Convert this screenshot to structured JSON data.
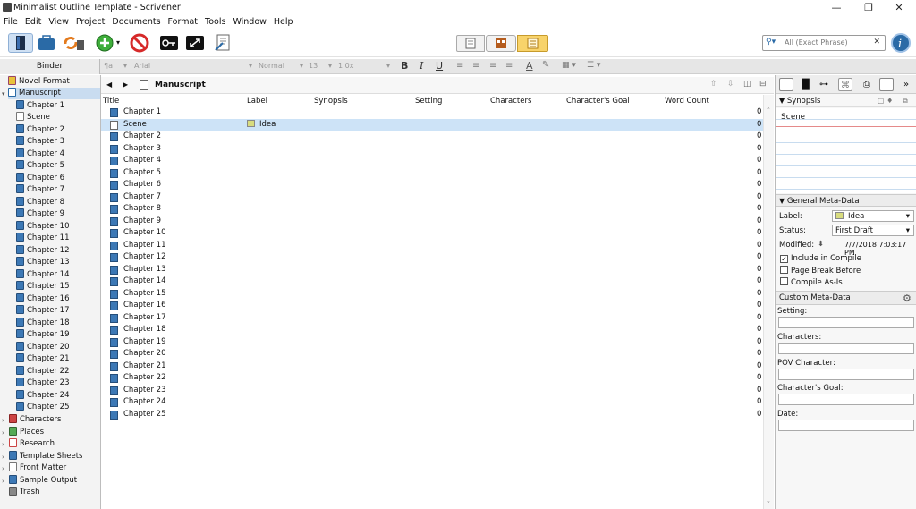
{
  "window": {
    "title": "Minimalist Outline Template - Scrivener",
    "min": "—",
    "max": "❐",
    "close": "✕"
  },
  "menu": [
    "File",
    "Edit",
    "View",
    "Project",
    "Documents",
    "Format",
    "Tools",
    "Window",
    "Help"
  ],
  "search": {
    "placeholder": "All (Exact Phrase)"
  },
  "format_bar": {
    "style": "¶a",
    "font": "Arial",
    "weight": "Normal",
    "size": "13",
    "spacing": "1.0x"
  },
  "binder": {
    "header": "Binder",
    "items": [
      {
        "label": "Novel Format"
      },
      {
        "label": "Manuscript"
      },
      {
        "label": "Chapter 1"
      },
      {
        "label": "Scene"
      },
      {
        "label": "Chapter 2"
      },
      {
        "label": "Chapter 3"
      },
      {
        "label": "Chapter 4"
      },
      {
        "label": "Chapter 5"
      },
      {
        "label": "Chapter 6"
      },
      {
        "label": "Chapter 7"
      },
      {
        "label": "Chapter 8"
      },
      {
        "label": "Chapter 9"
      },
      {
        "label": "Chapter 10"
      },
      {
        "label": "Chapter 11"
      },
      {
        "label": "Chapter 12"
      },
      {
        "label": "Chapter 13"
      },
      {
        "label": "Chapter 14"
      },
      {
        "label": "Chapter 15"
      },
      {
        "label": "Chapter 16"
      },
      {
        "label": "Chapter 17"
      },
      {
        "label": "Chapter 18"
      },
      {
        "label": "Chapter 19"
      },
      {
        "label": "Chapter 20"
      },
      {
        "label": "Chapter 21"
      },
      {
        "label": "Chapter 22"
      },
      {
        "label": "Chapter 23"
      },
      {
        "label": "Chapter 24"
      },
      {
        "label": "Chapter 25"
      },
      {
        "label": "Characters"
      },
      {
        "label": "Places"
      },
      {
        "label": "Research"
      },
      {
        "label": "Template Sheets"
      },
      {
        "label": "Front Matter"
      },
      {
        "label": "Sample Output"
      },
      {
        "label": "Trash"
      }
    ]
  },
  "outliner": {
    "title": "Manuscript",
    "columns": [
      "Title",
      "Label",
      "Synopsis",
      "Setting",
      "Characters",
      "Character's Goal",
      "Word Count"
    ],
    "rows": [
      {
        "title": "Chapter 1",
        "label": "",
        "wc": "0"
      },
      {
        "title": "Scene",
        "label": "Idea",
        "wc": "0"
      },
      {
        "title": "Chapter 2",
        "label": "",
        "wc": "0"
      },
      {
        "title": "Chapter 3",
        "label": "",
        "wc": "0"
      },
      {
        "title": "Chapter 4",
        "label": "",
        "wc": "0"
      },
      {
        "title": "Chapter 5",
        "label": "",
        "wc": "0"
      },
      {
        "title": "Chapter 6",
        "label": "",
        "wc": "0"
      },
      {
        "title": "Chapter 7",
        "label": "",
        "wc": "0"
      },
      {
        "title": "Chapter 8",
        "label": "",
        "wc": "0"
      },
      {
        "title": "Chapter 9",
        "label": "",
        "wc": "0"
      },
      {
        "title": "Chapter 10",
        "label": "",
        "wc": "0"
      },
      {
        "title": "Chapter 11",
        "label": "",
        "wc": "0"
      },
      {
        "title": "Chapter 12",
        "label": "",
        "wc": "0"
      },
      {
        "title": "Chapter 13",
        "label": "",
        "wc": "0"
      },
      {
        "title": "Chapter 14",
        "label": "",
        "wc": "0"
      },
      {
        "title": "Chapter 15",
        "label": "",
        "wc": "0"
      },
      {
        "title": "Chapter 16",
        "label": "",
        "wc": "0"
      },
      {
        "title": "Chapter 17",
        "label": "",
        "wc": "0"
      },
      {
        "title": "Chapter 18",
        "label": "",
        "wc": "0"
      },
      {
        "title": "Chapter 19",
        "label": "",
        "wc": "0"
      },
      {
        "title": "Chapter 20",
        "label": "",
        "wc": "0"
      },
      {
        "title": "Chapter 21",
        "label": "",
        "wc": "0"
      },
      {
        "title": "Chapter 22",
        "label": "",
        "wc": "0"
      },
      {
        "title": "Chapter 23",
        "label": "",
        "wc": "0"
      },
      {
        "title": "Chapter 24",
        "label": "",
        "wc": "0"
      },
      {
        "title": "Chapter 25",
        "label": "",
        "wc": "0"
      }
    ]
  },
  "inspector": {
    "synopsis_header": "Synopsis",
    "synopsis_text": "Scene",
    "general_header": "General Meta-Data",
    "label_caption": "Label:",
    "label_value": "Idea",
    "status_caption": "Status:",
    "status_value": "First Draft",
    "modified_caption": "Modified:",
    "modified_value": "7/7/2018 7:03:17 PM",
    "include_in_compile": "Include in Compile",
    "page_break_before": "Page Break Before",
    "compile_as_is": "Compile As-Is",
    "custom_header": "Custom Meta-Data",
    "fields": [
      "Setting:",
      "Characters:",
      "POV Character:",
      "Character's Goal:",
      "Date:"
    ]
  },
  "colors": {
    "selection": "#cde3f7",
    "accent": "#3c78b5",
    "label_idea": "#d8dc7e"
  }
}
